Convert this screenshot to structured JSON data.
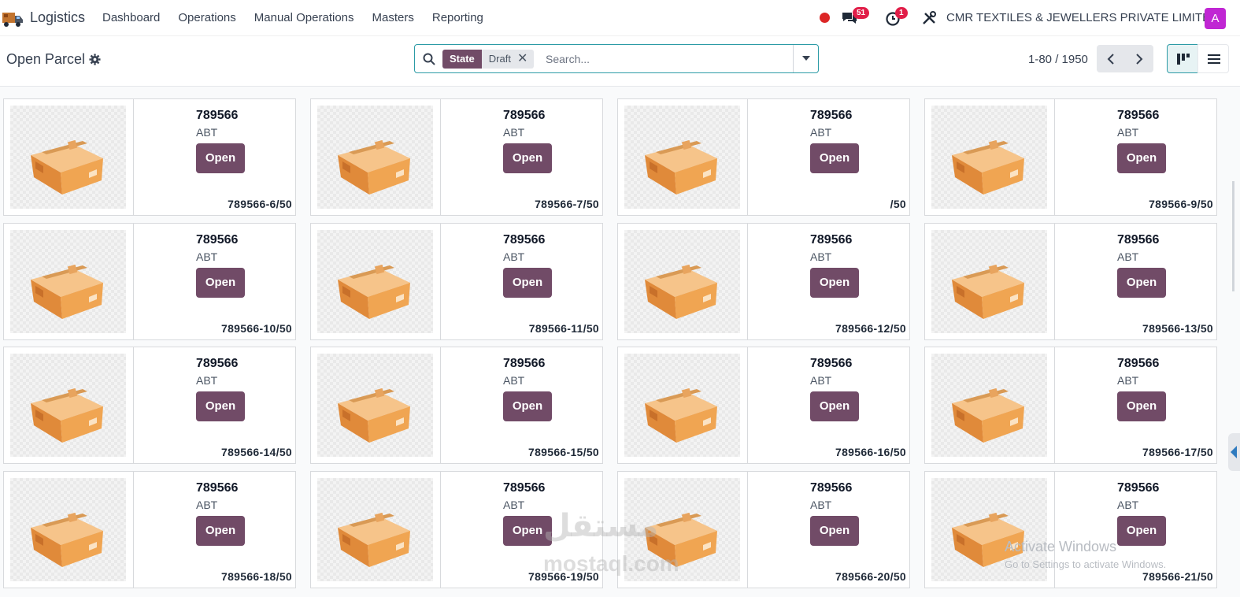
{
  "navbar": {
    "app_name": "Logistics",
    "menu": [
      "Dashboard",
      "Operations",
      "Manual Operations",
      "Masters",
      "Reporting"
    ],
    "chat_count": "51",
    "activity_count": "1",
    "company": "CMR TEXTILES & JEWELLERS PRIVATE LIMITED",
    "avatar_letter": "A",
    "record_dot_color": "#dc2626",
    "avatar_color": "#c026d3"
  },
  "control": {
    "title": "Open Parcel",
    "facet_label": "State",
    "facet_value": "Draft",
    "search_placeholder": "Search...",
    "pager": "1-80 / 1950"
  },
  "colors": {
    "primary": "#714b67",
    "accent": "#2c9ba6"
  },
  "cards": [
    {
      "name": "789566",
      "sub": "ABT",
      "button": "Open",
      "ref": "789566-6/50"
    },
    {
      "name": "789566",
      "sub": "ABT",
      "button": "Open",
      "ref": "789566-7/50"
    },
    {
      "name": "789566",
      "sub": "ABT",
      "button": "Open",
      "ref": "/50"
    },
    {
      "name": "789566",
      "sub": "ABT",
      "button": "Open",
      "ref": "789566-9/50"
    },
    {
      "name": "789566",
      "sub": "ABT",
      "button": "Open",
      "ref": "789566-10/50"
    },
    {
      "name": "789566",
      "sub": "ABT",
      "button": "Open",
      "ref": "789566-11/50"
    },
    {
      "name": "789566",
      "sub": "ABT",
      "button": "Open",
      "ref": "789566-12/50"
    },
    {
      "name": "789566",
      "sub": "ABT",
      "button": "Open",
      "ref": "789566-13/50"
    },
    {
      "name": "789566",
      "sub": "ABT",
      "button": "Open",
      "ref": "789566-14/50"
    },
    {
      "name": "789566",
      "sub": "ABT",
      "button": "Open",
      "ref": "789566-15/50"
    },
    {
      "name": "789566",
      "sub": "ABT",
      "button": "Open",
      "ref": "789566-16/50"
    },
    {
      "name": "789566",
      "sub": "ABT",
      "button": "Open",
      "ref": "789566-17/50"
    },
    {
      "name": "789566",
      "sub": "ABT",
      "button": "Open",
      "ref": "789566-18/50"
    },
    {
      "name": "789566",
      "sub": "ABT",
      "button": "Open",
      "ref": "789566-19/50"
    },
    {
      "name": "789566",
      "sub": "ABT",
      "button": "Open",
      "ref": "789566-20/50"
    },
    {
      "name": "789566",
      "sub": "ABT",
      "button": "Open",
      "ref": "789566-21/50"
    }
  ],
  "watermarks": {
    "activate_title": "Activate Windows",
    "activate_sub": "Go to Settings to activate Windows.",
    "logo": "مستقل",
    "site": "mostaql.com"
  }
}
